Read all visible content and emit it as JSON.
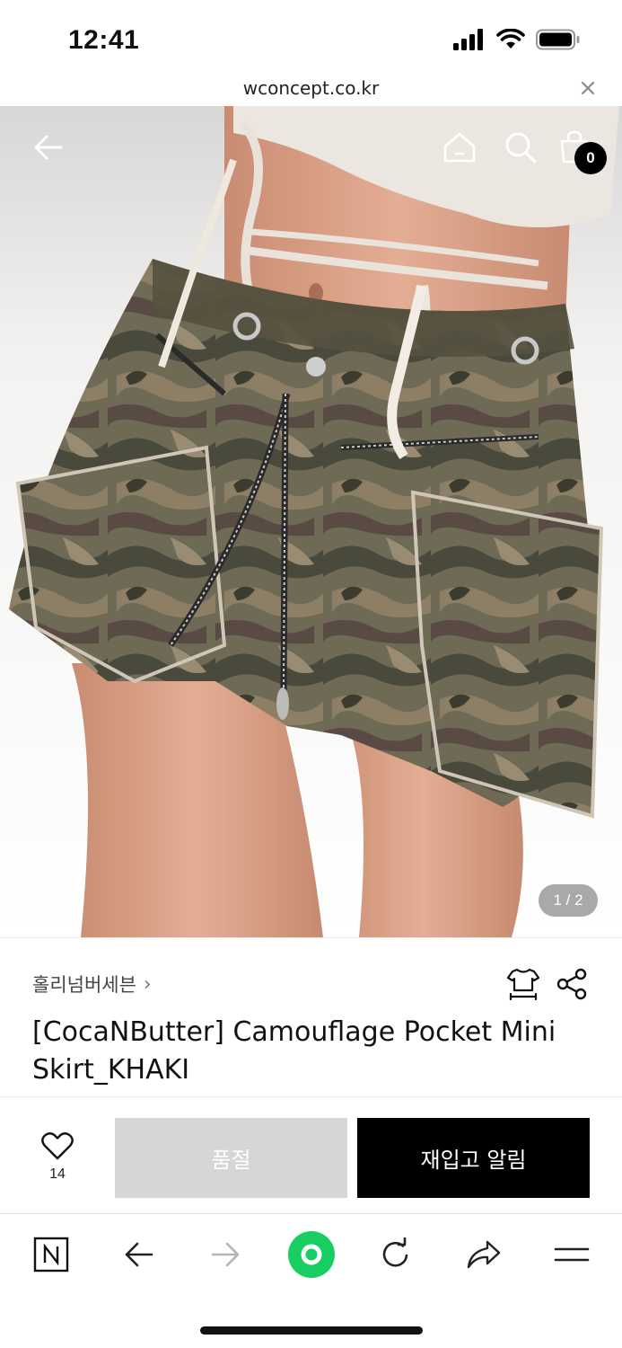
{
  "status_bar": {
    "time": "12:41",
    "icons": [
      "signal-icon",
      "wifi-icon",
      "battery-icon"
    ]
  },
  "url_bar": {
    "url": "wconcept.co.kr",
    "close_icon": "close-icon"
  },
  "hero": {
    "page_indicator": "1 / 2",
    "cart_count": "0",
    "nav_icons": [
      "back-arrow-icon",
      "home-icon",
      "search-icon",
      "shopping-bag-icon"
    ]
  },
  "product": {
    "brand": "홀리넘버세븐",
    "brand_chevron": "›",
    "title": "[CocaNButter] Camouflage Pocket Mini Skirt_KHAKI",
    "icons": [
      "size-guide-icon",
      "share-icon"
    ]
  },
  "actions": {
    "wish_count": "14",
    "soldout_label": "품절",
    "restock_label": "재입고 알림"
  },
  "browser_toolbar": {
    "icons": [
      "naver-n-icon",
      "back-icon",
      "forward-icon",
      "green-dot-icon",
      "reload-icon",
      "share-arrow-icon",
      "menu-icon"
    ]
  },
  "colors": {
    "accent_green": "#19ce60",
    "restock_bg": "#000000",
    "soldout_bg": "#d6d6d6"
  }
}
